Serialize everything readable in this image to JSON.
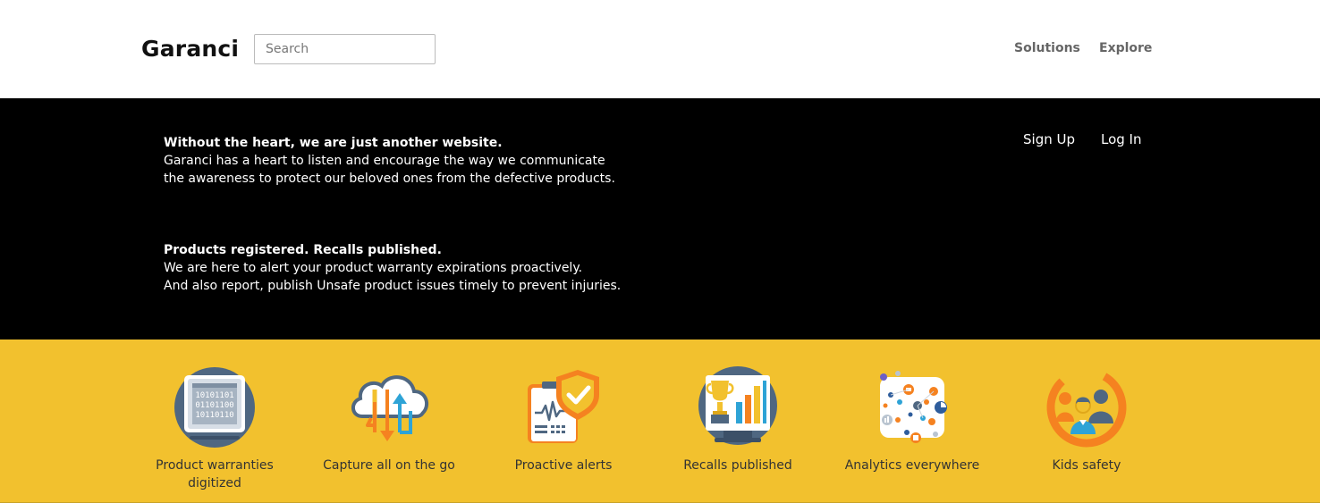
{
  "header": {
    "brand": "Garanci",
    "search_placeholder": "Search",
    "nav": {
      "solutions": "Solutions",
      "explore": "Explore"
    }
  },
  "hero": {
    "blocks": [
      {
        "heading": "Without the heart, we are just another website.",
        "lines": [
          "Garanci has a heart to listen and encourage the way we communicate",
          "the awareness to protect our beloved ones from the defective products."
        ]
      },
      {
        "heading": "Products registered. Recalls published.",
        "lines": [
          "We are here to alert your product warranty expirations proactively.",
          "And also report, publish Unsafe product issues timely to prevent injuries."
        ]
      }
    ],
    "auth": {
      "signup": "Sign Up",
      "login": "Log In"
    }
  },
  "features": [
    {
      "label_1": "Product warranties",
      "label_2": "digitized",
      "icon": "digital-chip-icon"
    },
    {
      "label_1": "Capture all on the go",
      "icon": "cloud-sync-icon"
    },
    {
      "label_1": "Proactive alerts",
      "icon": "shield-check-icon"
    },
    {
      "label_1": "Recalls published",
      "icon": "trophy-chart-icon"
    },
    {
      "label_1": "Analytics everywhere",
      "icon": "analytics-network-icon"
    },
    {
      "label_1": "Kids safety",
      "icon": "family-icon"
    }
  ],
  "colors": {
    "hero_background": "#000000",
    "features_background": "#f2c12e",
    "icon_slate": "#4f6781",
    "icon_orange": "#f58220",
    "icon_blue": "#2ea3d6"
  }
}
